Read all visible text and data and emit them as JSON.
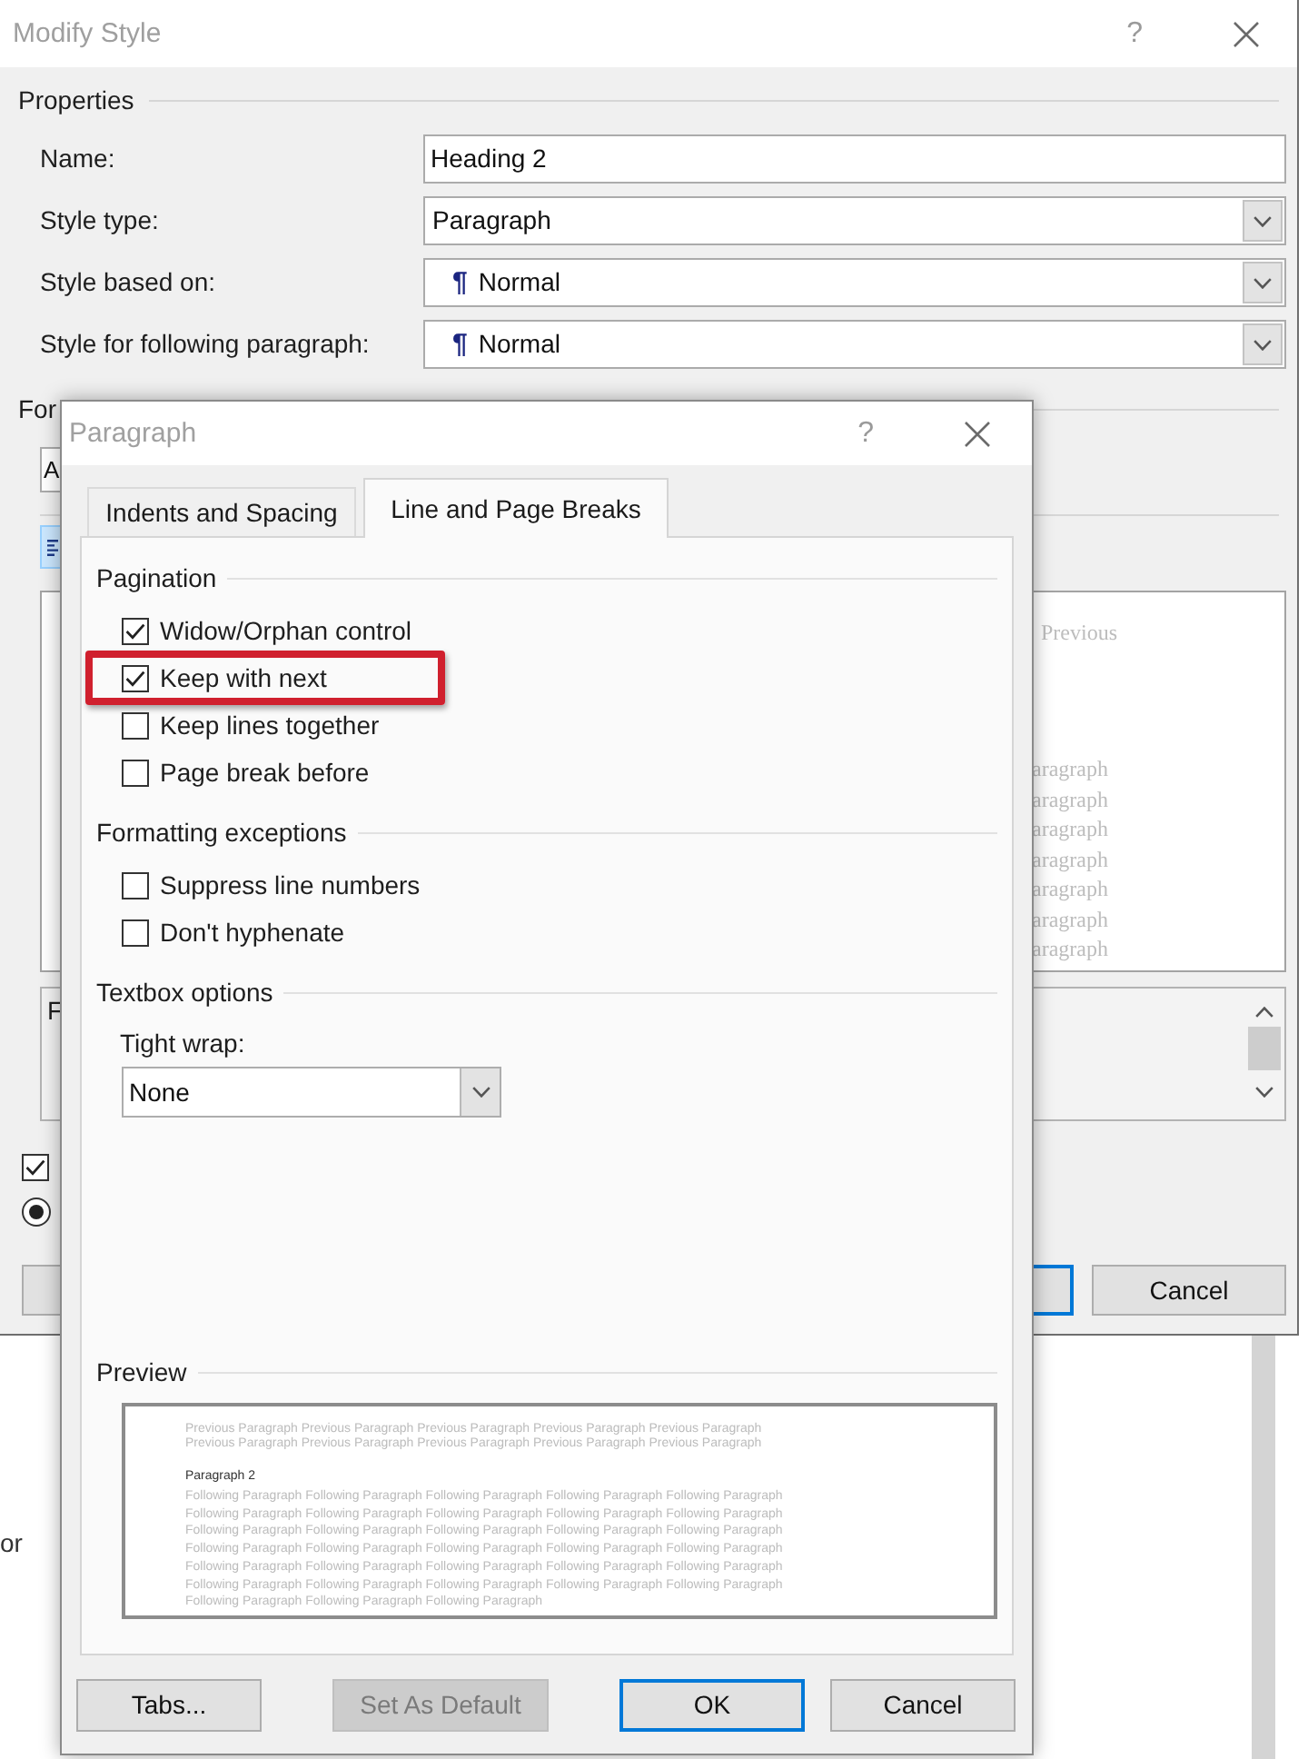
{
  "modify_style_dialog": {
    "title": "Modify Style",
    "help_glyph": "?",
    "properties_heading": "Properties",
    "fields": [
      {
        "label": "Name:",
        "kind": "text",
        "value": "Heading 2"
      },
      {
        "label": "Style type:",
        "kind": "dropdown",
        "value": "Paragraph"
      },
      {
        "label": "Style based on:",
        "kind": "style_dropdown",
        "mark": "¶",
        "value": "Normal"
      },
      {
        "label": "Style for following paragraph:",
        "kind": "style_dropdown",
        "mark": "¶",
        "value": "Normal"
      }
    ],
    "label_fragment": "For",
    "font_box": "A",
    "preview": {
      "top_fragment": "Previous",
      "line_fragments": [
        "aragraph",
        "aragraph",
        "aragraph",
        "aragraph",
        "aragraph",
        "aragraph",
        "aragraph"
      ]
    },
    "description_fragment": "F",
    "options": [
      {
        "kind": "checkbox",
        "checked": true
      },
      {
        "kind": "radio",
        "selected": true
      }
    ],
    "buttons": [
      {
        "default": false
      },
      {
        "default": true
      },
      {
        "label": "Cancel",
        "default": false
      }
    ]
  },
  "document": {
    "text_fragment": "or"
  },
  "paragraph_dialog": {
    "title": "Paragraph",
    "help_glyph": "?",
    "tabs": [
      {
        "label": "Indents and Spacing",
        "selected": false
      },
      {
        "label": "Line and Page Breaks",
        "selected": true
      }
    ],
    "sections": [
      {
        "heading": "Pagination",
        "items": [
          {
            "kind": "checkbox",
            "label": "Widow/Orphan control",
            "checked": true,
            "highlighted": false
          },
          {
            "kind": "checkbox",
            "label": "Keep with next",
            "checked": true,
            "highlighted": true
          },
          {
            "kind": "checkbox",
            "label": "Keep lines together",
            "checked": false,
            "highlighted": false
          },
          {
            "kind": "checkbox",
            "label": "Page break before",
            "checked": false,
            "highlighted": false
          }
        ]
      },
      {
        "heading": "Formatting exceptions",
        "items": [
          {
            "kind": "checkbox",
            "label": "Suppress line numbers",
            "checked": false,
            "highlighted": false
          },
          {
            "kind": "checkbox",
            "label": "Don't hyphenate",
            "checked": false,
            "highlighted": false
          }
        ]
      },
      {
        "heading": "Textbox options",
        "items": [
          {
            "kind": "dropdown",
            "label": "Tight wrap:",
            "value": "None"
          }
        ]
      }
    ],
    "preview": {
      "heading": "Preview",
      "previous_lines": [
        "Previous Paragraph Previous Paragraph Previous Paragraph Previous Paragraph Previous Paragraph",
        "Previous Paragraph Previous Paragraph Previous Paragraph Previous Paragraph Previous Paragraph"
      ],
      "current": "Paragraph 2",
      "following_lines": [
        "Following Paragraph Following Paragraph Following Paragraph Following Paragraph Following Paragraph",
        "Following Paragraph Following Paragraph Following Paragraph Following Paragraph Following Paragraph",
        "Following Paragraph Following Paragraph Following Paragraph Following Paragraph Following Paragraph",
        "Following Paragraph Following Paragraph Following Paragraph Following Paragraph Following Paragraph",
        "Following Paragraph Following Paragraph Following Paragraph Following Paragraph Following Paragraph",
        "Following Paragraph Following Paragraph Following Paragraph Following Paragraph Following Paragraph",
        "Following Paragraph Following Paragraph Following Paragraph"
      ]
    },
    "buttons": [
      {
        "label": "Tabs...",
        "disabled": false,
        "default": false
      },
      {
        "label": "Set As Default",
        "disabled": true,
        "default": false
      },
      {
        "label": "OK",
        "disabled": false,
        "default": true
      },
      {
        "label": "Cancel",
        "disabled": false,
        "default": false
      }
    ]
  }
}
